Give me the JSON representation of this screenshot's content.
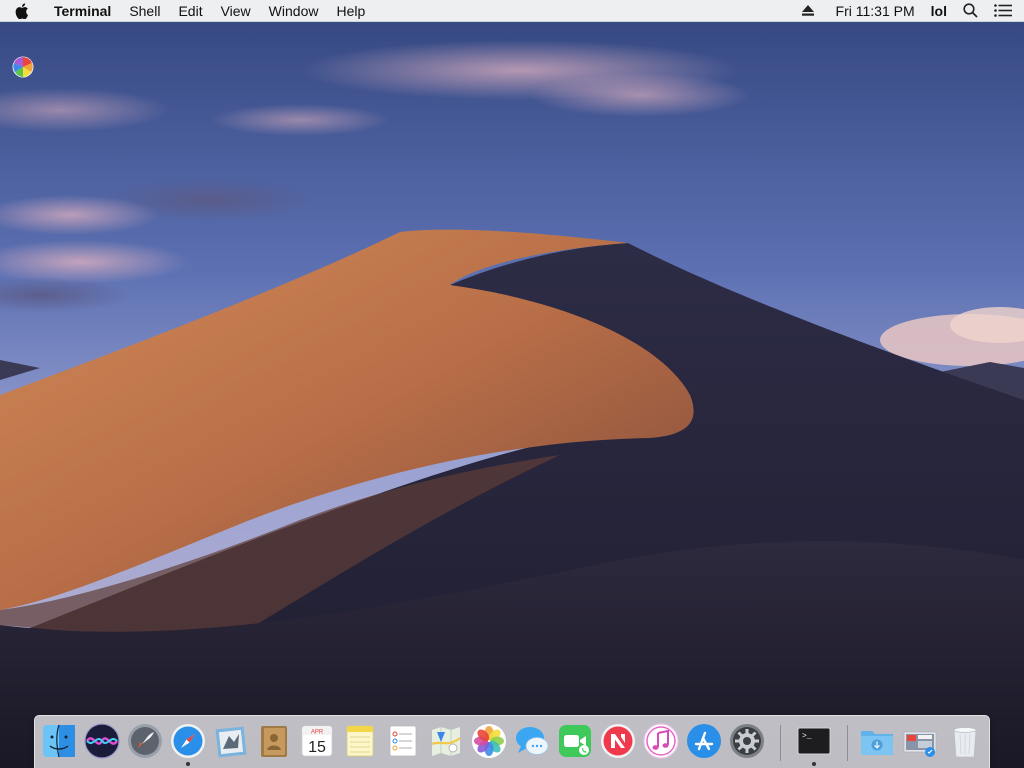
{
  "menubar": {
    "app_name": "Terminal",
    "menus": [
      "Shell",
      "Edit",
      "View",
      "Window",
      "Help"
    ],
    "clock": "Fri 11:31 PM",
    "user": "lol"
  },
  "calendar_icon": {
    "month": "APR",
    "day": "15"
  },
  "terminal_icon": {
    "prompt": ">_"
  },
  "dock_items": [
    {
      "name": "finder-icon",
      "running": false
    },
    {
      "name": "siri-icon",
      "running": false
    },
    {
      "name": "launchpad-icon",
      "running": false
    },
    {
      "name": "safari-icon",
      "running": true
    },
    {
      "name": "mail-icon",
      "running": false
    },
    {
      "name": "contacts-icon",
      "running": false
    },
    {
      "name": "calendar-icon",
      "running": false
    },
    {
      "name": "notes-icon",
      "running": false
    },
    {
      "name": "reminders-icon",
      "running": false
    },
    {
      "name": "maps-icon",
      "running": false
    },
    {
      "name": "photos-icon",
      "running": false
    },
    {
      "name": "messages-icon",
      "running": false
    },
    {
      "name": "facetime-icon",
      "running": false
    },
    {
      "name": "news-icon",
      "running": false
    },
    {
      "name": "itunes-icon",
      "running": false
    },
    {
      "name": "app-store-icon",
      "running": false
    },
    {
      "name": "system-preferences-icon",
      "running": false
    },
    {
      "name": "terminal-icon",
      "running": true
    },
    {
      "name": "downloads-folder-icon",
      "running": false
    },
    {
      "name": "screenshots-stack-icon",
      "running": false
    },
    {
      "name": "trash-icon",
      "running": false
    }
  ],
  "colors": {
    "sky_top": "#3c4f8f",
    "sky_bottom": "#8f9bd0",
    "dune_lit": "#c47a4e",
    "dune_shadow": "#2b2a3f",
    "menubar_bg": "#f6f6f6"
  }
}
